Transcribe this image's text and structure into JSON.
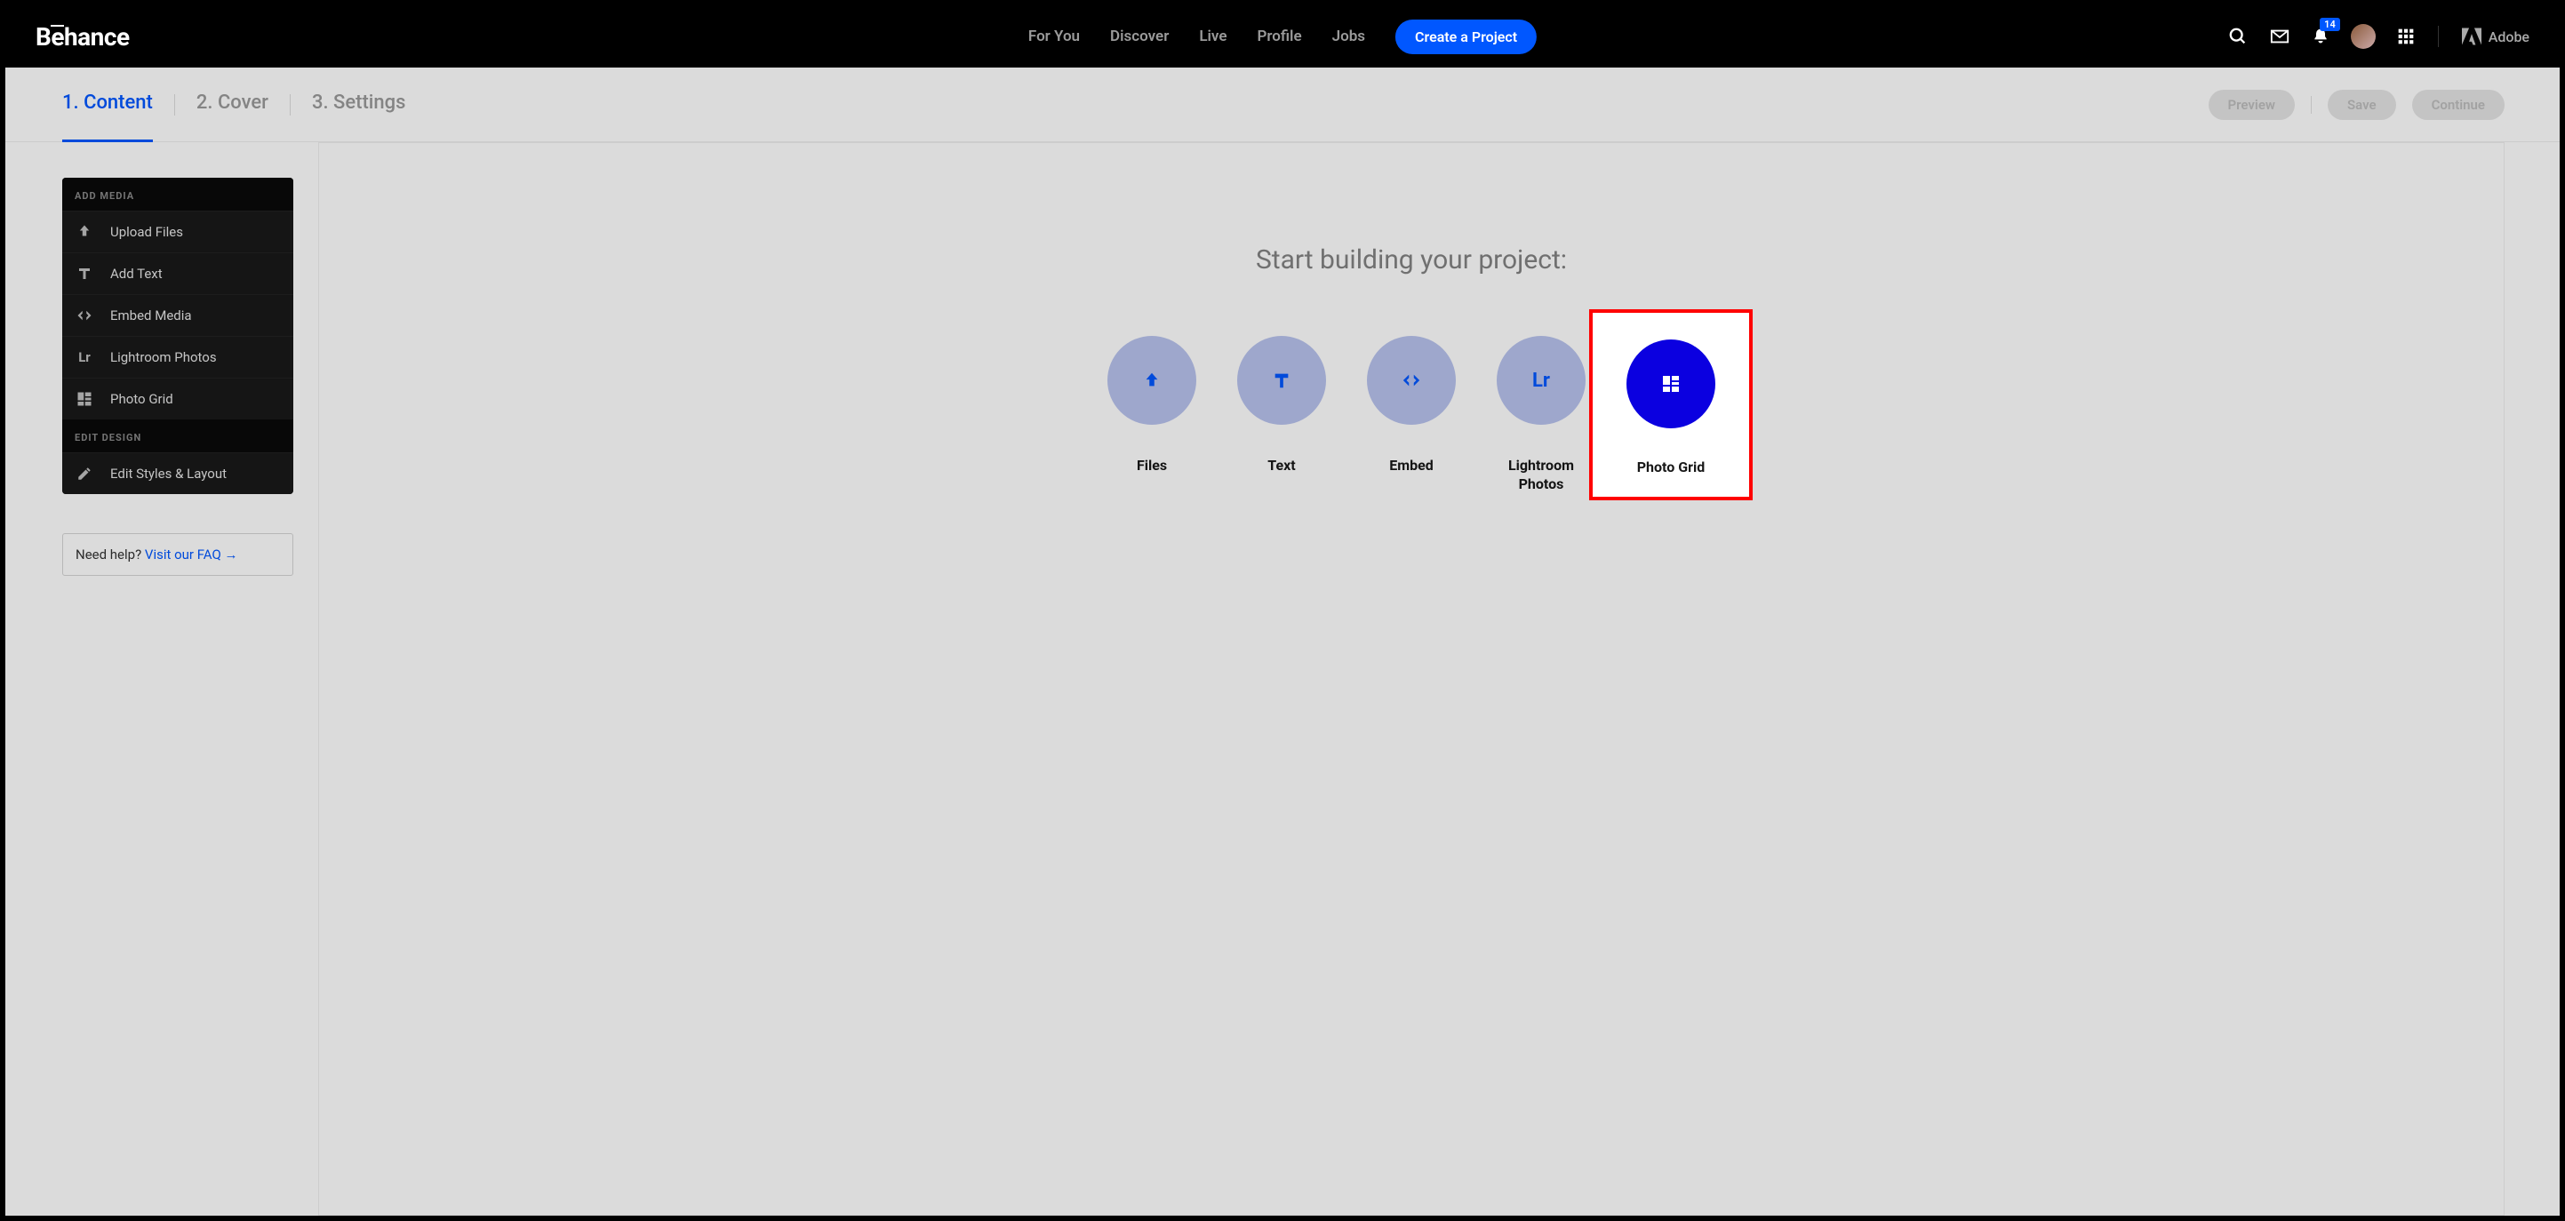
{
  "brand": "Bēhance",
  "nav": {
    "items": [
      "For You",
      "Discover",
      "Live",
      "Profile",
      "Jobs"
    ],
    "cta": "Create a Project"
  },
  "notifications_count": "14",
  "adobe_label": "Adobe",
  "subheader": {
    "steps": [
      "1. Content",
      "2. Cover",
      "3. Settings"
    ],
    "active_index": 0,
    "buttons": {
      "preview": "Preview",
      "save": "Save",
      "continue": "Continue"
    }
  },
  "sidebar": {
    "section1_title": "ADD MEDIA",
    "items": [
      {
        "label": "Upload Files",
        "icon": "upload"
      },
      {
        "label": "Add Text",
        "icon": "text"
      },
      {
        "label": "Embed Media",
        "icon": "embed"
      },
      {
        "label": "Lightroom Photos",
        "icon": "lr"
      },
      {
        "label": "Photo Grid",
        "icon": "grid"
      }
    ],
    "section2_title": "EDIT DESIGN",
    "edit_item": {
      "label": "Edit Styles & Layout",
      "icon": "pencil"
    }
  },
  "help": {
    "text": "Need help? ",
    "link_text": "Visit our FAQ →"
  },
  "canvas": {
    "title": "Start building your project:",
    "tiles": [
      {
        "label": "Files",
        "icon": "upload"
      },
      {
        "label": "Text",
        "icon": "text"
      },
      {
        "label": "Embed",
        "icon": "embed"
      },
      {
        "label": "Lightroom\nPhotos",
        "icon": "lr"
      },
      {
        "label": "Photo Grid",
        "icon": "grid",
        "highlighted": true
      }
    ]
  }
}
